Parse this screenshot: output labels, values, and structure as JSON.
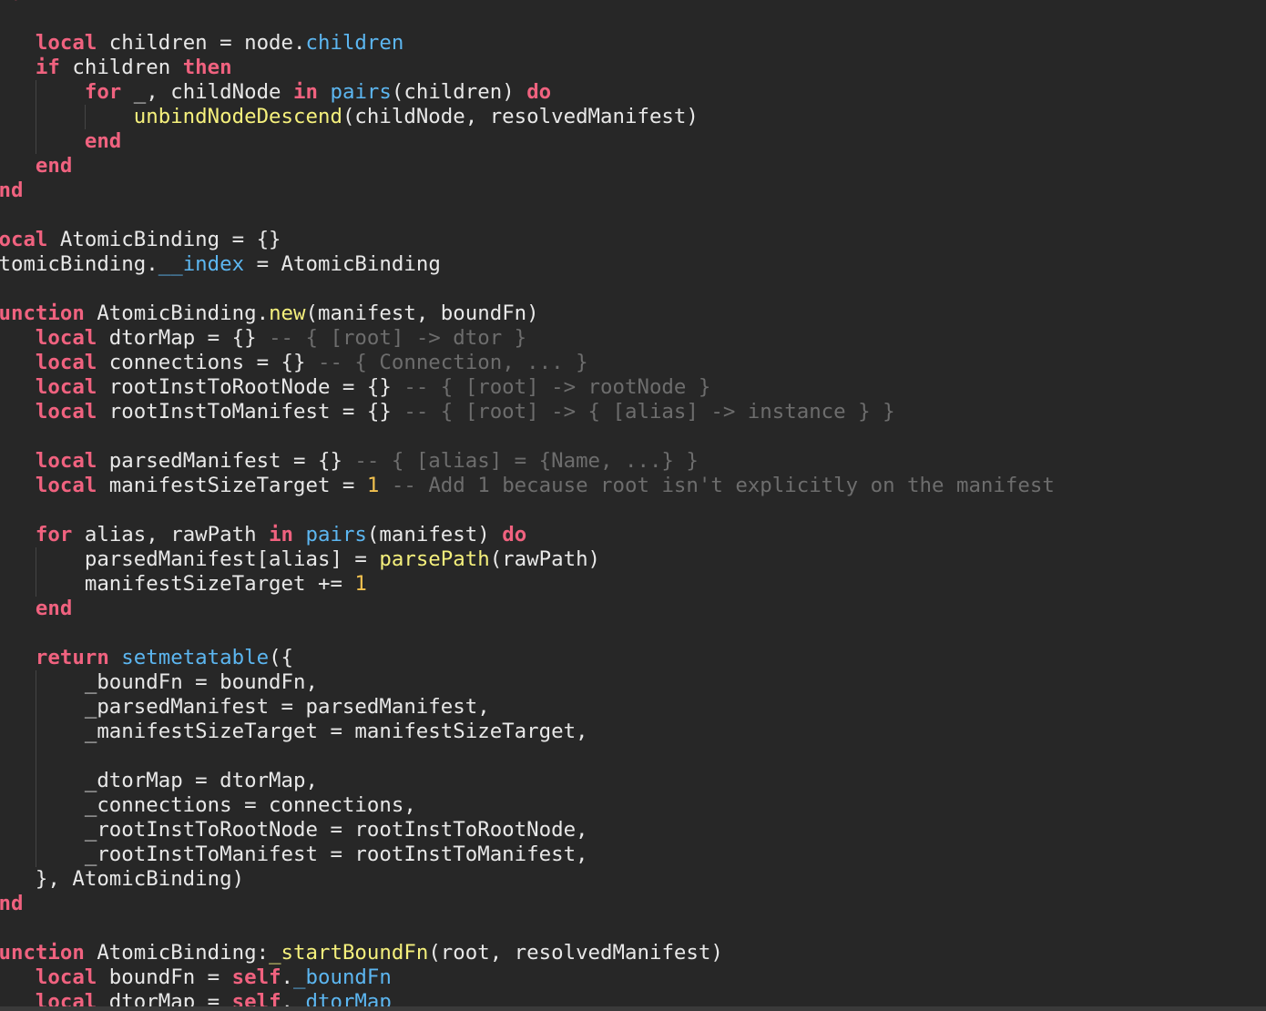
{
  "editor": {
    "lines": [
      [
        [
          "kw",
          "end"
        ]
      ],
      [],
      [
        [
          "pl",
          "    "
        ],
        [
          "kw",
          "local"
        ],
        [
          "pl",
          " children = node."
        ],
        [
          "prop",
          "children"
        ]
      ],
      [
        [
          "pl",
          "    "
        ],
        [
          "kw",
          "if"
        ],
        [
          "pl",
          " children "
        ],
        [
          "kw",
          "then"
        ]
      ],
      [
        [
          "pl",
          "        "
        ],
        [
          "kw",
          "for"
        ],
        [
          "pl",
          " _, childNode "
        ],
        [
          "kw",
          "in"
        ],
        [
          "pl",
          " "
        ],
        [
          "bi",
          "pairs"
        ],
        [
          "pl",
          "(children) "
        ],
        [
          "kw",
          "do"
        ]
      ],
      [
        [
          "pl",
          "            "
        ],
        [
          "fn",
          "unbindNodeDescend"
        ],
        [
          "pl",
          "(childNode, resolvedManifest)"
        ]
      ],
      [
        [
          "pl",
          "        "
        ],
        [
          "kw",
          "end"
        ]
      ],
      [
        [
          "pl",
          "    "
        ],
        [
          "kw",
          "end"
        ]
      ],
      [
        [
          "kw",
          "end"
        ]
      ],
      [],
      [
        [
          "kw",
          "local"
        ],
        [
          "pl",
          " AtomicBinding = {}"
        ]
      ],
      [
        [
          "pl",
          "AtomicBinding."
        ],
        [
          "prop",
          "__index"
        ],
        [
          "pl",
          " = AtomicBinding"
        ]
      ],
      [],
      [
        [
          "kw",
          "function"
        ],
        [
          "pl",
          " AtomicBinding."
        ],
        [
          "fn",
          "new"
        ],
        [
          "pl",
          "(manifest, boundFn)"
        ]
      ],
      [
        [
          "pl",
          "    "
        ],
        [
          "kw",
          "local"
        ],
        [
          "pl",
          " dtorMap = {} "
        ],
        [
          "cm",
          "-- { [root] -> dtor }"
        ]
      ],
      [
        [
          "pl",
          "    "
        ],
        [
          "kw",
          "local"
        ],
        [
          "pl",
          " connections = {} "
        ],
        [
          "cm",
          "-- { Connection, ... }"
        ]
      ],
      [
        [
          "pl",
          "    "
        ],
        [
          "kw",
          "local"
        ],
        [
          "pl",
          " rootInstToRootNode = {} "
        ],
        [
          "cm",
          "-- { [root] -> rootNode }"
        ]
      ],
      [
        [
          "pl",
          "    "
        ],
        [
          "kw",
          "local"
        ],
        [
          "pl",
          " rootInstToManifest = {} "
        ],
        [
          "cm",
          "-- { [root] -> { [alias] -> instance } }"
        ]
      ],
      [],
      [
        [
          "pl",
          "    "
        ],
        [
          "kw",
          "local"
        ],
        [
          "pl",
          " parsedManifest = {} "
        ],
        [
          "cm",
          "-- { [alias] = {Name, ...} }"
        ]
      ],
      [
        [
          "pl",
          "    "
        ],
        [
          "kw",
          "local"
        ],
        [
          "pl",
          " manifestSizeTarget = "
        ],
        [
          "num",
          "1"
        ],
        [
          "pl",
          " "
        ],
        [
          "cm",
          "-- Add 1 because root isn't explicitly on the manifest"
        ]
      ],
      [],
      [
        [
          "pl",
          "    "
        ],
        [
          "kw",
          "for"
        ],
        [
          "pl",
          " alias, rawPath "
        ],
        [
          "kw",
          "in"
        ],
        [
          "pl",
          " "
        ],
        [
          "bi",
          "pairs"
        ],
        [
          "pl",
          "(manifest) "
        ],
        [
          "kw",
          "do"
        ]
      ],
      [
        [
          "pl",
          "        parsedManifest[alias] = "
        ],
        [
          "fn",
          "parsePath"
        ],
        [
          "pl",
          "(rawPath)"
        ]
      ],
      [
        [
          "pl",
          "        manifestSizeTarget += "
        ],
        [
          "num",
          "1"
        ]
      ],
      [
        [
          "pl",
          "    "
        ],
        [
          "kw",
          "end"
        ]
      ],
      [],
      [
        [
          "pl",
          "    "
        ],
        [
          "kw",
          "return"
        ],
        [
          "pl",
          " "
        ],
        [
          "bi",
          "setmetatable"
        ],
        [
          "pl",
          "({"
        ]
      ],
      [
        [
          "pl",
          "        _boundFn = boundFn,"
        ]
      ],
      [
        [
          "pl",
          "        _parsedManifest = parsedManifest,"
        ]
      ],
      [
        [
          "pl",
          "        _manifestSizeTarget = manifestSizeTarget,"
        ]
      ],
      [],
      [
        [
          "pl",
          "        _dtorMap = dtorMap,"
        ]
      ],
      [
        [
          "pl",
          "        _connections = connections,"
        ]
      ],
      [
        [
          "pl",
          "        _rootInstToRootNode = rootInstToRootNode,"
        ]
      ],
      [
        [
          "pl",
          "        _rootInstToManifest = rootInstToManifest,"
        ]
      ],
      [
        [
          "pl",
          "    }, AtomicBinding)"
        ]
      ],
      [
        [
          "kw",
          "end"
        ]
      ],
      [],
      [
        [
          "kw",
          "function"
        ],
        [
          "pl",
          " AtomicBinding:"
        ],
        [
          "fn",
          "_startBoundFn"
        ],
        [
          "pl",
          "(root, resolvedManifest)"
        ]
      ],
      [
        [
          "pl",
          "    "
        ],
        [
          "kw",
          "local"
        ],
        [
          "pl",
          " boundFn = "
        ],
        [
          "kw",
          "self"
        ],
        [
          "pl",
          "."
        ],
        [
          "prop",
          "_boundFn"
        ]
      ],
      [
        [
          "pl",
          "    "
        ],
        [
          "kw",
          "local"
        ],
        [
          "pl",
          " dtorMap = "
        ],
        [
          "kw",
          "self"
        ],
        [
          "pl",
          "."
        ],
        [
          "prop",
          "_dtorMap"
        ]
      ]
    ],
    "indent_guides": [
      [],
      [],
      [],
      [],
      [
        1
      ],
      [
        1,
        2
      ],
      [
        1
      ],
      [],
      [],
      [],
      [],
      [],
      [],
      [],
      [],
      [],
      [],
      [],
      [],
      [],
      [],
      [],
      [],
      [
        1
      ],
      [
        1
      ],
      [],
      [],
      [],
      [
        1
      ],
      [
        1
      ],
      [
        1
      ],
      [
        1
      ],
      [
        1
      ],
      [
        1
      ],
      [
        1
      ],
      [
        1
      ],
      [],
      [],
      [],
      [],
      [],
      []
    ]
  }
}
